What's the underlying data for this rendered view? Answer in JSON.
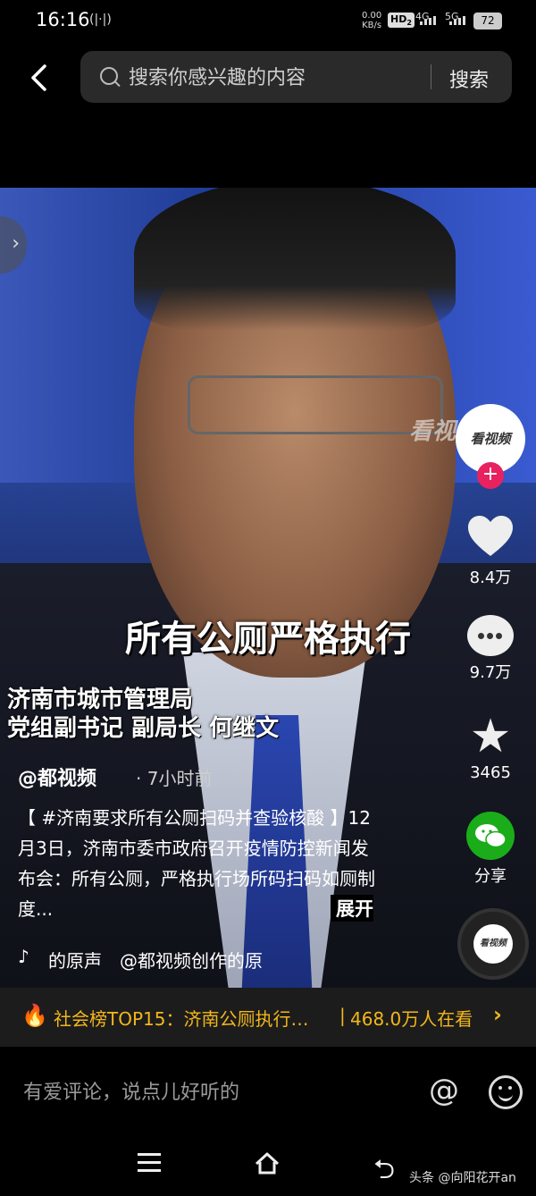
{
  "status_bar": {
    "time": "16:16",
    "vibrate_icon": "vibrate-icon",
    "net_speed_value": "0.00",
    "net_speed_unit": "KB/s",
    "hd_badge": "HD",
    "hd_sub": "2",
    "signal1": "4G",
    "signal2": "5G",
    "battery": "72"
  },
  "search": {
    "placeholder": "搜索你感兴趣的内容",
    "button_label": "搜索"
  },
  "video": {
    "watermark": "看视",
    "caption_main": "所有公厕严格执行",
    "caption_line1": "济南市城市管理局",
    "caption_line2": "党组副书记 副局长 何继文"
  },
  "post": {
    "author": "@都视频",
    "time_ago": "· 7小时前",
    "description": "【 #济南要求所有公厕扫码并查验核酸 】12月3日，济南市委市政府召开疫情防控新闻发布会：所有公厕，严格执行场所码扫码如厕制度...",
    "expand_label": "展开",
    "music": "的原声　@都视频创作的原"
  },
  "actions": {
    "avatar_text": "看视频",
    "follow": "+",
    "likes": "8.4万",
    "comments": "9.7万",
    "favorites": "3465",
    "share": "分享",
    "disc_text": "看视频"
  },
  "hot_rank": {
    "text": "社会榜TOP15：济南公厕执行…",
    "separator": "|",
    "viewers": "468.0万人在看",
    "arrow": "›"
  },
  "comment_bar": {
    "placeholder": "有爱评论，说点儿好听的",
    "at_icon": "@"
  },
  "watermark_brand": "头条 @向阳花开an",
  "colors": {
    "accent_follow": "#e8225f",
    "hot_text": "#f3b71b",
    "wechat": "#1aad19"
  }
}
